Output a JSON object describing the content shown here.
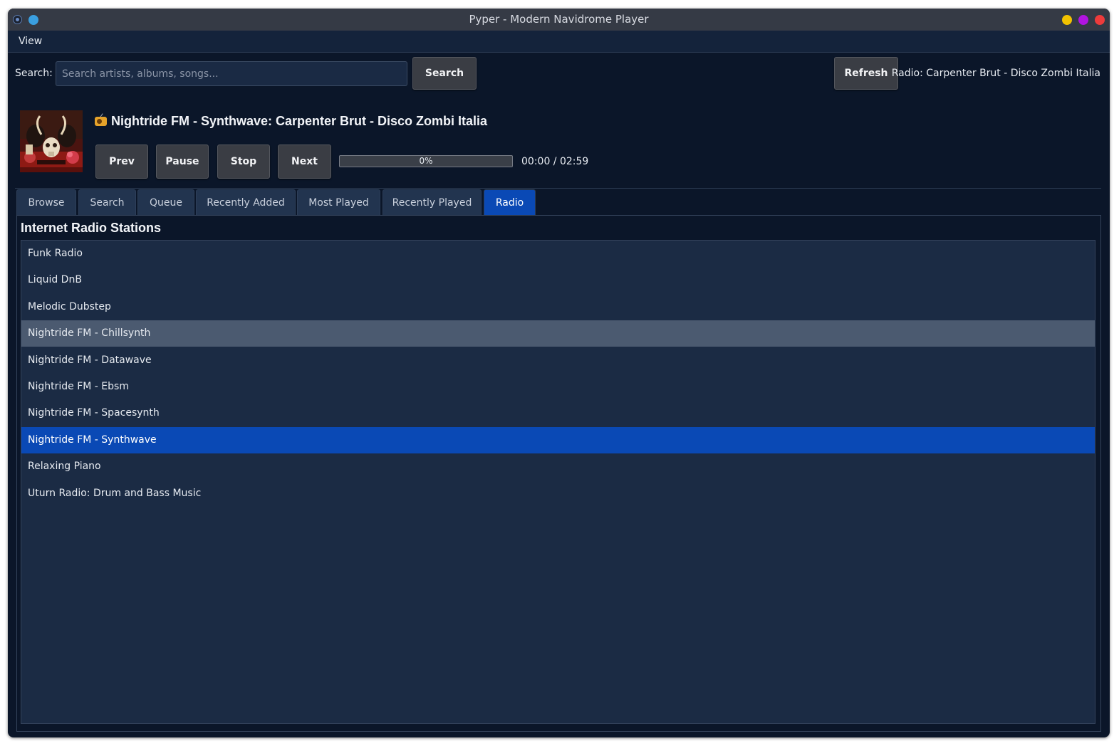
{
  "window": {
    "title": "Pyper - Modern Navidrome Player",
    "controls": [
      {
        "name": "minimize",
        "color": "#f2c200"
      },
      {
        "name": "maximize",
        "color": "#b114e0"
      },
      {
        "name": "close",
        "color": "#ef3b3b"
      }
    ]
  },
  "menu": {
    "items": [
      "View"
    ]
  },
  "search": {
    "label": "Search:",
    "placeholder": "Search artists, albums, songs...",
    "value": "",
    "button_label": "Search"
  },
  "toolbar": {
    "refresh_label": "Refresh",
    "status": "Radio: Carpenter Brut - Disco Zombi Italia"
  },
  "player": {
    "album_art_icon": "album-art",
    "now_playing_icon": "radio-icon",
    "now_playing": "Nightride FM - Synthwave: Carpenter Brut - Disco Zombi Italia",
    "buttons": {
      "prev": "Prev",
      "pause": "Pause",
      "stop": "Stop",
      "next": "Next"
    },
    "progress_percent": 0,
    "progress_label": "0%",
    "time": "00:00 / 02:59"
  },
  "tabs": [
    {
      "label": "Browse",
      "active": false
    },
    {
      "label": "Search",
      "active": false
    },
    {
      "label": "Queue",
      "active": false
    },
    {
      "label": "Recently Added",
      "active": false
    },
    {
      "label": "Most Played",
      "active": false
    },
    {
      "label": "Recently Played",
      "active": false
    },
    {
      "label": "Radio",
      "active": true
    }
  ],
  "radio": {
    "title": "Internet Radio Stations",
    "stations": [
      {
        "name": "Funk Radio",
        "state": "normal"
      },
      {
        "name": "Liquid DnB",
        "state": "normal"
      },
      {
        "name": "Melodic Dubstep",
        "state": "normal"
      },
      {
        "name": "Nightride FM - Chillsynth",
        "state": "hover"
      },
      {
        "name": "Nightride FM - Datawave",
        "state": "normal"
      },
      {
        "name": "Nightride FM - Ebsm",
        "state": "normal"
      },
      {
        "name": "Nightride FM - Spacesynth",
        "state": "normal"
      },
      {
        "name": "Nightride FM - Synthwave",
        "state": "selected"
      },
      {
        "name": "Relaxing Piano",
        "state": "normal"
      },
      {
        "name": "Uturn Radio: Drum and Bass Music",
        "state": "normal"
      }
    ]
  },
  "colors": {
    "background": "#0b1629",
    "list_background": "#1b2b44",
    "accent": "#0a49b5",
    "hover": "#4b5a70"
  }
}
